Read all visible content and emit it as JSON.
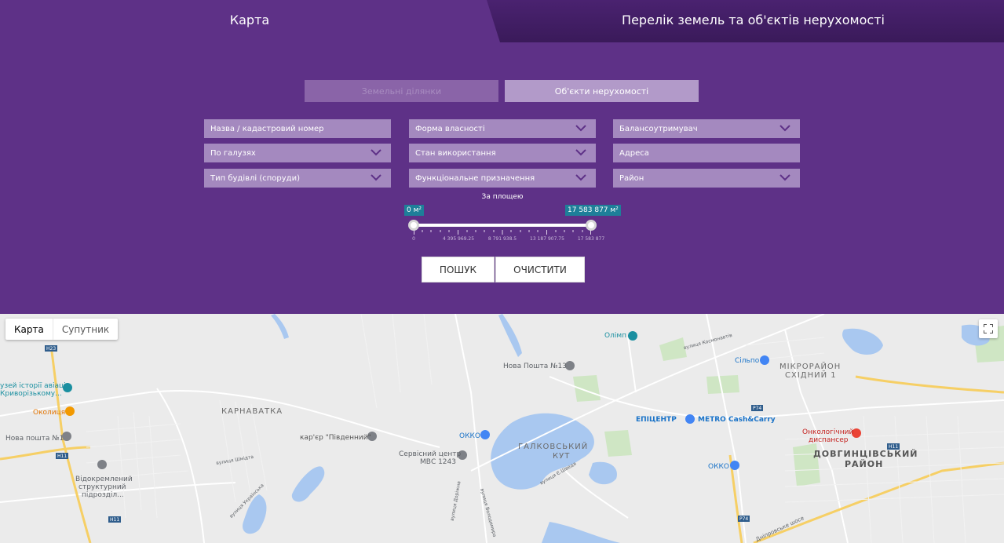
{
  "tabs": {
    "map": "Карта",
    "list": "Перелік земель та об'єктів нерухомості"
  },
  "segments": {
    "land": "Земельні ділянки",
    "objects": "Об'єкти нерухомості"
  },
  "filters": {
    "name": "Назва / кадастровий номер",
    "ownership": "Форма власності",
    "holder": "Балансоутримувач",
    "industry": "По галузях",
    "usage": "Стан використання",
    "address": "Адреса",
    "building_type": "Тип будівлі (споруди)",
    "purpose": "Функціональне призначення",
    "district": "Район"
  },
  "slider": {
    "title": "За площею",
    "min_label": "0 м²",
    "max_label": "17 583 877 м²",
    "ticks": [
      "0",
      "4 395 969.25",
      "8 791 938.5",
      "13 187 907.75",
      "17 583 877"
    ],
    "value_min": 0,
    "value_max": 17583877
  },
  "buttons": {
    "search": "ПОШУК",
    "clear": "ОЧИСТИТИ"
  },
  "map": {
    "type_map": "Карта",
    "type_satellite": "Супутник",
    "labels": {
      "karnavatka": "КАРНАВАТКА",
      "galkovsky": "ГАЛКОВСЬКИЙ",
      "kut": "КУТ",
      "mikro1": "МІКРОРАЙОН",
      "mikro2": "СХІДНИЙ 1",
      "dovh1": "ДОВГИНЦІВСЬКИЙ",
      "dovh2": "РАЙОН",
      "olimp": "Олімп",
      "np13": "Нова Пошта №13",
      "silpo": "Сільпо",
      "epicentr": "ЕПІЦЕНТР",
      "metro": "METRO Cash&Carry",
      "onko1": "Онкологічний",
      "onko2": "диспансер",
      "okko1": "ОККО",
      "okko2": "ОККО",
      "kar": "кар'єр \"Південний\"",
      "servis1": "Сервісний центр",
      "servis2": "МВС 1243",
      "np1": "Нова пошта №1",
      "okolytsia": "Околиця",
      "muzei1": "узей історії авіаці",
      "muzei2": "Криворізькому...",
      "vidokr1": "Відокремлений",
      "vidokr2": "структурний",
      "vidokr3": "підрозділ...",
      "street_shmita": "вулиця Шмідта",
      "street_ukr": "вулиця Українська",
      "street_shv": "вулиця Є.Шведа",
      "street_volod": "вулиця Володимира",
      "street_doroh": "вулиця Доріжна",
      "street_kom": "вулиця Космонавтів",
      "street_dniprovske": "Дніпровське шосе",
      "road_h23": "H23",
      "road_h11a": "H11",
      "road_h11b": "H11",
      "road_h11c": "H11",
      "road_p74a": "P74",
      "road_p74b": "P74"
    }
  }
}
